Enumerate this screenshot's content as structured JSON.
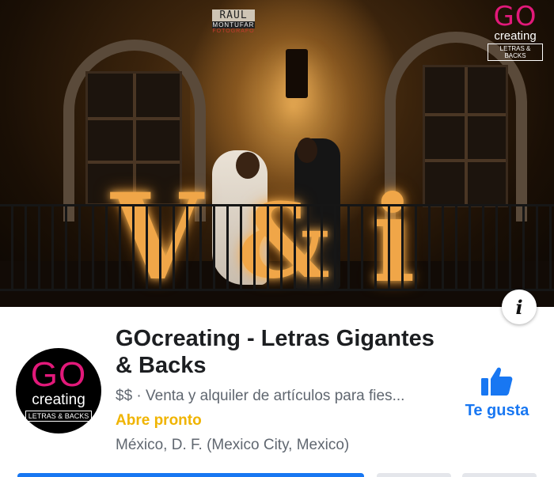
{
  "cover": {
    "photographer_watermark": {
      "name": "RAUL",
      "surname": "MONTUFAR",
      "role": "FOTOGRAFO"
    },
    "brand_logo": {
      "go": "GO",
      "creating": "creating",
      "tagline": "LETRAS & BACKS"
    },
    "marquee_letters": [
      "V",
      "&",
      "i"
    ],
    "info_icon": "info-icon",
    "info_glyph": "i"
  },
  "profile": {
    "avatar": {
      "go": "GO",
      "creating": "creating",
      "tagline": "LETRAS & BACKS"
    },
    "name": "GOcreating - Letras Gigantes & Backs",
    "category": "$$ · Venta y alquiler de artículos para fies...",
    "hours_status": "Abre pronto",
    "location": "México, D. F. (Mexico City, Mexico)"
  },
  "actions": {
    "like_icon": "thumbs-up-icon",
    "like_label": "Te gusta"
  },
  "colors": {
    "brand_pink": "#e2197a",
    "facebook_blue": "#1877f2",
    "hours_yellow": "#f0b400",
    "secondary_text": "#606770",
    "primary_text": "#1c1e21"
  }
}
